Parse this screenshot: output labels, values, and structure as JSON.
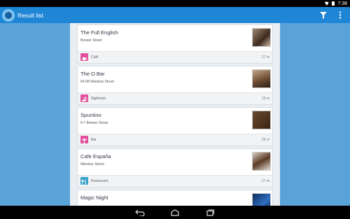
{
  "status_bar": {
    "time": "7:38"
  },
  "action_bar": {
    "title": "Result list",
    "filter_icon": "filter-icon",
    "more_icon": "overflow-menu-icon"
  },
  "results": [
    {
      "name": "The Full English",
      "address": "Brewer Street",
      "category": "Café",
      "distance": "17 m",
      "category_color": "#e3529c",
      "thumb_color": "#7a5b45"
    },
    {
      "name": "The O Bar",
      "address": "54-58 Wardour Street",
      "category": "Nightclub",
      "distance": "19 m",
      "category_color": "#e3529c",
      "thumb_color": "#8b6a4f"
    },
    {
      "name": "Spuntino",
      "address": "5-7 Brewer Street",
      "category": "Bar",
      "distance": "25 m",
      "category_color": "#e3529c",
      "thumb_color": "#5a3a22"
    },
    {
      "name": "Cafe España",
      "address": "Wardour Street",
      "category": "Restaurant",
      "distance": "27 m",
      "category_color": "#3aa3c9",
      "thumb_color": "#6b4a35"
    },
    {
      "name": "Magic Night",
      "address": "",
      "category": "",
      "distance": "",
      "category_color": "#e3529c",
      "thumb_color": "#1b3f7a"
    }
  ],
  "nav_bar": {
    "back_icon": "back-icon",
    "home_icon": "home-icon",
    "recents_icon": "recents-icon"
  }
}
